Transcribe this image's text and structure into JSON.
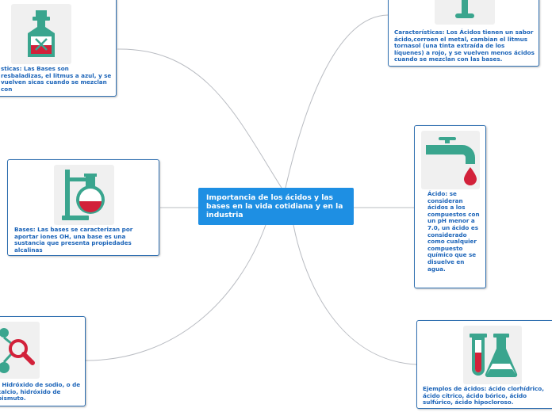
{
  "central": {
    "title": "Importancia de los ácidos y las bases en la vida cotidiana y en la industria"
  },
  "nodes": {
    "bases_characteristics": {
      "text": "sticas: Las Bases son resbaladizas, el litmus a azul, y se vuelven sicas cuando se mezclan con",
      "icon": "potion-bottle-icon"
    },
    "bases_definition": {
      "text": "Bases: Las bases se caracterizan por aportar iones OH, una base es una sustancia que presenta propiedades alcalinas",
      "icon": "lab-flask-stand-icon"
    },
    "bases_examples": {
      "text": ": Hidróxido de sodio, o de calcio, hidróxido de bismuto.",
      "icon": "molecule-magnifier-icon"
    },
    "acids_characteristics": {
      "text": "Características: Los Ácidos tienen un sabor ácido,corroen el metal, cambian el litmus tornasol (una tinta extraída de los líquenes) a rojo, y se vuelven menos ácidos cuando se mezclan con las bases.",
      "icon": "test-tube-stand-icon"
    },
    "acid_definition": {
      "text": "Ácido: se consideran ácidos a los compuestos con un pH menor a 7.0, un ácido es considerado como cualquier compuesto químico que se disuelve en agua.",
      "icon": "faucet-drop-icon"
    },
    "acid_examples": {
      "text": "Ejemplos de ácidos: ácido clorhídrico, ácido cítrico, ácido bórico, ácido sulfúrico, ácido hipocloroso.",
      "icon": "test-tube-flask-icon"
    }
  },
  "colors": {
    "central": "#1e8fe3",
    "node_text": "#1a63b8",
    "node_border": "#2f6fb0",
    "connector": "#b9bcc2",
    "teal": "#3aa58e",
    "red": "#d2213a"
  }
}
